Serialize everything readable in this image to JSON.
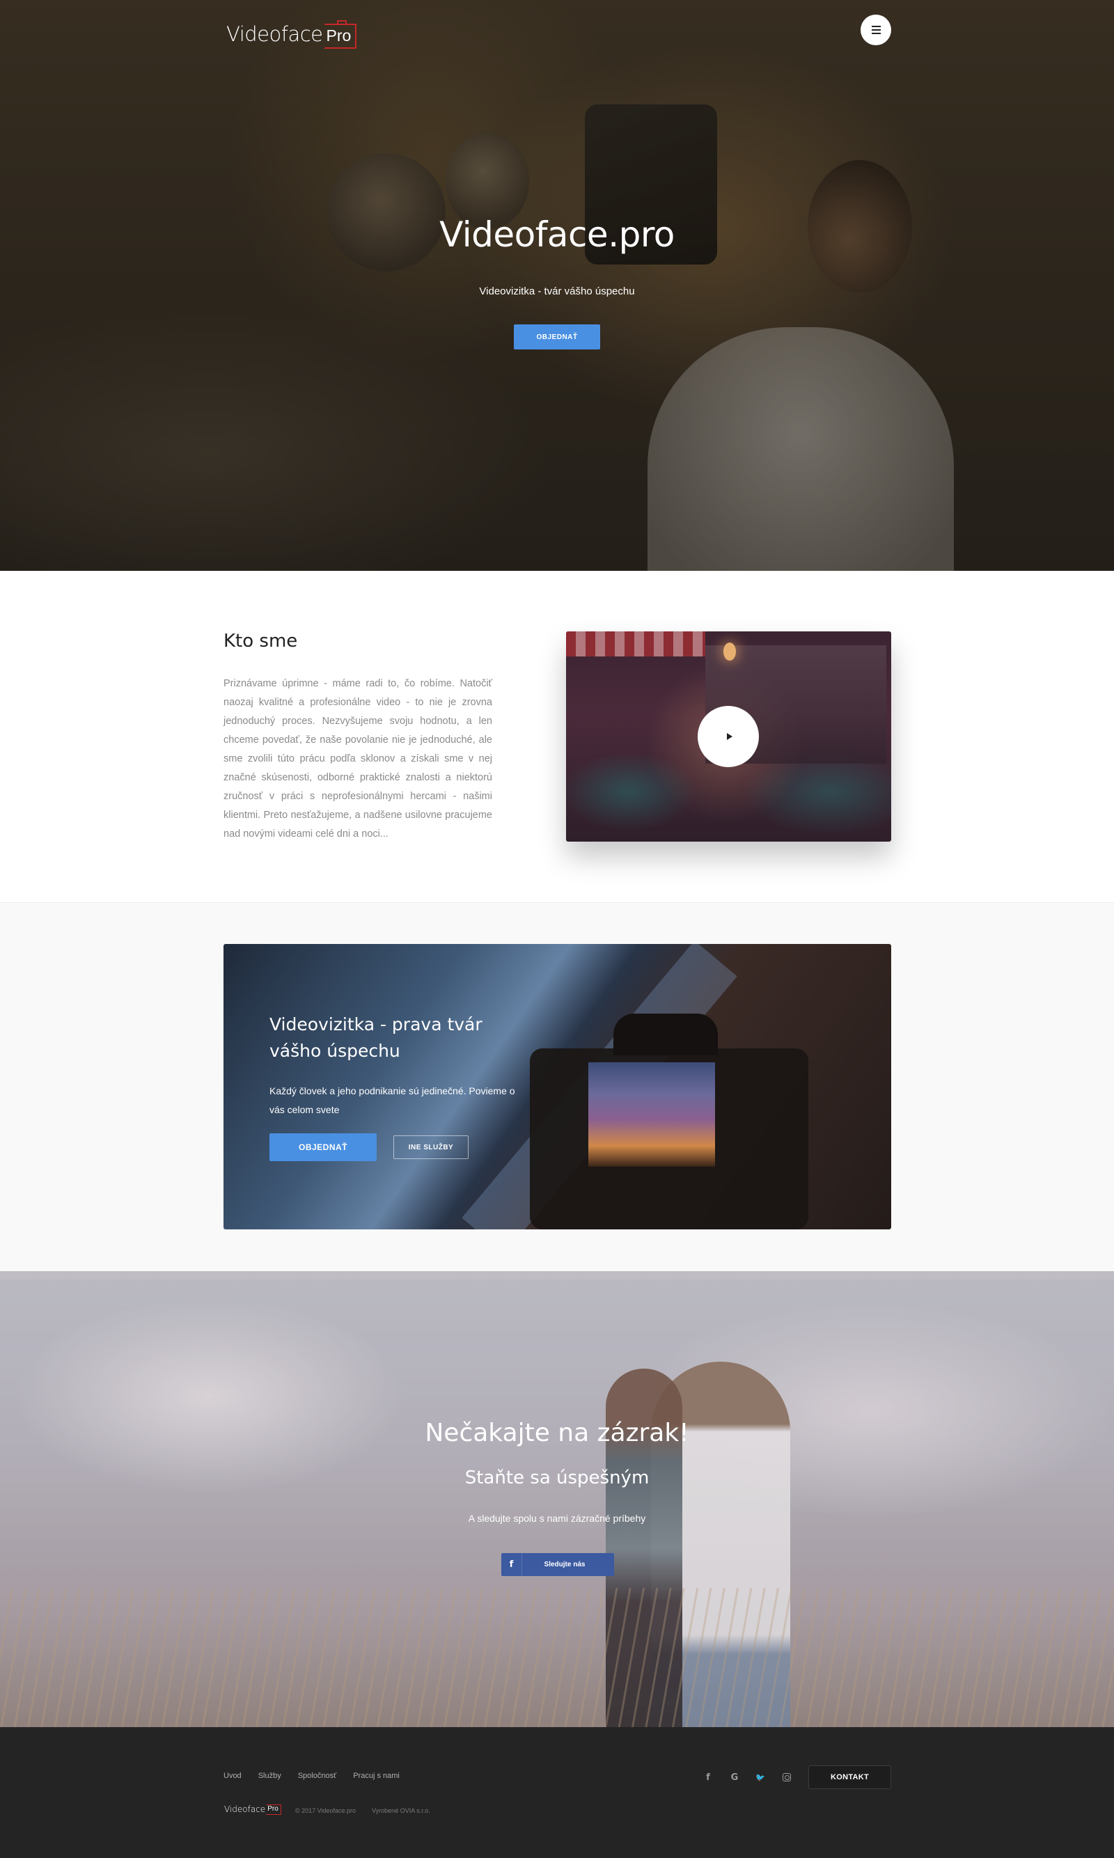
{
  "brand": {
    "name": "Videoface",
    "suffix": "Pro"
  },
  "hero": {
    "title": "Videoface.pro",
    "subtitle": "Videovizitka - tvár vášho úspechu",
    "cta": "OBJEDNAŤ"
  },
  "about": {
    "title": "Kto sme",
    "text": "Priznávame úprimne - máme radi to, čo robíme. Natočiť naozaj kvalitné a profesionálne video - to nie je zrovna jednoduchý proces. Nezvyšujeme svoju hodnotu, a len chceme povedať, že naše povolanie nie je jednoduché, ale sme zvolili túto prácu podľa sklonov a získali sme v nej značné skúsenosti, odborné praktické znalosti a niektorú zručnosť v práci s neprofesionálnymi hercami - našimi klientmi. Preto nesťažujeme, a nadšene usilovne pracujeme nad novými videami celé dni a noci..."
  },
  "promo": {
    "title": "Videovizitka - prava tvár vášho úspechu",
    "text": "Každý človek a jeho podnikanie sú jedinečné. Povieme o vás celom svete",
    "primary": "OBJEDNAŤ",
    "secondary": "INE SLUŽBY"
  },
  "couple": {
    "title": "Nečakajte na zázrak!",
    "subtitle": "Staňte sa úspešným",
    "text": "A sledujte spolu s nami zázračné príbehy",
    "fb_label": "Sledujte nás",
    "fb_glyph": "f"
  },
  "footer": {
    "nav": [
      "Uvod",
      "Služby",
      "Spoločnosť",
      "Pracuj s nami"
    ],
    "social": [
      {
        "name": "facebook-icon",
        "glyph": "f"
      },
      {
        "name": "google-icon",
        "glyph": "G"
      },
      {
        "name": "twitter-icon",
        "glyph": "🐦"
      },
      {
        "name": "instagram-icon",
        "glyph": ""
      }
    ],
    "contact": "KONTAKT",
    "copyright": "© 2017 Videoface.pro",
    "made_by": "Vyrobené OVIA s.r.o."
  },
  "colors": {
    "accent": "#4a90e2",
    "facebook": "#3b5aa0",
    "logo_red": "#c62828",
    "footer_bg": "#242424"
  }
}
